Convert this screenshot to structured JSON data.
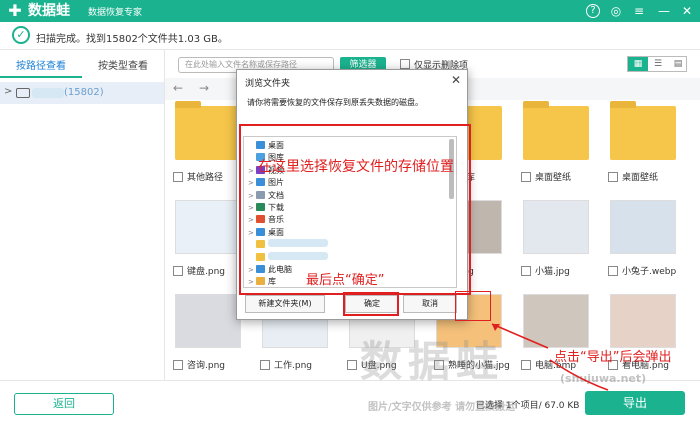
{
  "app": {
    "logo_glyph": "✚",
    "name": "数据蛙",
    "subtitle": "数据恢复专家",
    "title_icons": [
      "question-icon",
      "minimize-icon",
      "close-icon"
    ]
  },
  "scan": {
    "status": "扫描完成。找到15802个文件共1.03 GB。"
  },
  "tabs": [
    {
      "label": "按路径查看",
      "active": true
    },
    {
      "label": "按类型查看",
      "active": false
    }
  ],
  "tree": {
    "count": "(15802)"
  },
  "toolbar": {
    "search_placeholder": "在此处输入文件名称或保存路径",
    "filter_label": "筛选器",
    "only_deleted_label": "仅显示删除项"
  },
  "files": [
    {
      "name": "其他路径",
      "kind": "folder"
    },
    {
      "name": "",
      "kind": "folder"
    },
    {
      "name": "",
      "kind": "folder"
    },
    {
      "name": "",
      "kind": "folder"
    },
    {
      "name": "",
      "kind": "folder"
    },
    {
      "name": "",
      "kind": "folder"
    },
    {
      "name": "",
      "kind": "folder"
    },
    {
      "name": "",
      "kind": "folder"
    },
    {
      "name": "",
      "kind": "folder"
    },
    {
      "name": "",
      "kind": "folder"
    },
    {
      "name": "",
      "kind": "folder"
    },
    {
      "name": "",
      "kind": "folder"
    },
    {
      "name": "",
      "kind": "folder"
    },
    {
      "name": "",
      "kind": "folder"
    },
    {
      "name": "",
      "kind": "folder"
    },
    {
      "name": "",
      "kind": "folder"
    },
    {
      "name": "",
      "kind": "folder"
    },
    {
      "name": "",
      "kind": "folder"
    },
    {
      "name": "",
      "kind": "folder"
    },
    {
      "name": "",
      "kind": "folder"
    },
    {
      "name": "",
      "kind": "folder"
    },
    {
      "name": "",
      "kind": "folder"
    }
  ],
  "tiles": [
    {
      "name": "其他路径",
      "kind": "folder"
    },
    {
      "name": "",
      "kind": "folder"
    },
    {
      "name": "",
      "kind": "folder"
    },
    {
      "name": "敢图库",
      "kind": "folder"
    },
    {
      "name": "桌面壁纸",
      "kind": "folder"
    },
    {
      "name": "桌面壁纸",
      "kind": "folder"
    },
    {
      "name": "键盘.png",
      "kind": "photo"
    },
    {
      "name": "",
      "kind": "photo"
    },
    {
      "name": "",
      "kind": "photo"
    },
    {
      "name": "天.jpg",
      "kind": "photo"
    },
    {
      "name": "小猫.jpg",
      "kind": "photo"
    },
    {
      "name": "小兔子.webp",
      "kind": "photo"
    },
    {
      "name": "咨询.png",
      "kind": "photo"
    },
    {
      "name": "工作.png",
      "kind": "photo"
    },
    {
      "name": "U盘.png",
      "kind": "photo"
    },
    {
      "name": "熟睡的小猫.jpg",
      "kind": "photo"
    },
    {
      "name": "电脑.bmp",
      "kind": "photo"
    },
    {
      "name": "看电脑.png",
      "kind": "photo"
    }
  ],
  "bottom": {
    "back_label": "返回",
    "selected_info": "已选择 1个项目/ 67.0 KB",
    "export_label": "导出"
  },
  "watermark": {
    "big": "数据蛙",
    "small": "图片/文字仅供参考 请勿直接搬运",
    "url": "(shujuwa.net)"
  },
  "dialog": {
    "title": "浏览文件夹",
    "close_glyph": "✕",
    "description": "请你将需要恢复的文件保存到原丢失数据的磁盘。",
    "items": [
      {
        "label": "桌面",
        "icon": "desktop-icon",
        "color": "#3a8fd8",
        "expandable": false
      },
      {
        "label": "图库",
        "icon": "gallery-icon",
        "color": "#4aa0e0",
        "expandable": false
      },
      {
        "label": "视频",
        "icon": "video-icon",
        "color": "#7a3fc4",
        "expandable": true
      },
      {
        "label": "图片",
        "icon": "pictures-icon",
        "color": "#3a8fd8",
        "expandable": true
      },
      {
        "label": "文档",
        "icon": "documents-icon",
        "color": "#8a9bb0",
        "expandable": true
      },
      {
        "label": "下载",
        "icon": "download-icon",
        "color": "#2a8a5a",
        "expandable": true
      },
      {
        "label": "音乐",
        "icon": "music-icon",
        "color": "#e05030",
        "expandable": true
      },
      {
        "label": "桌面",
        "icon": "desktop-icon",
        "color": "#3a8fd8",
        "expandable": true
      },
      {
        "label": "",
        "icon": "folder-icon",
        "color": "#f0c040",
        "expandable": false
      },
      {
        "label": "",
        "icon": "folder-icon",
        "color": "#f0c040",
        "expandable": false
      },
      {
        "label": "此电脑",
        "icon": "computer-icon",
        "color": "#3a8fd8",
        "expandable": true
      },
      {
        "label": "库",
        "icon": "library-icon",
        "color": "#e8b040",
        "expandable": true
      }
    ],
    "new_folder_label": "新建文件夹(M)",
    "ok_label": "确定",
    "cancel_label": "取消"
  },
  "annotations": {
    "choose_location": "在这里选择恢复文件的存储位置",
    "click_ok": "最后点“确定”",
    "click_export": "点击“导出”后会弹出"
  }
}
